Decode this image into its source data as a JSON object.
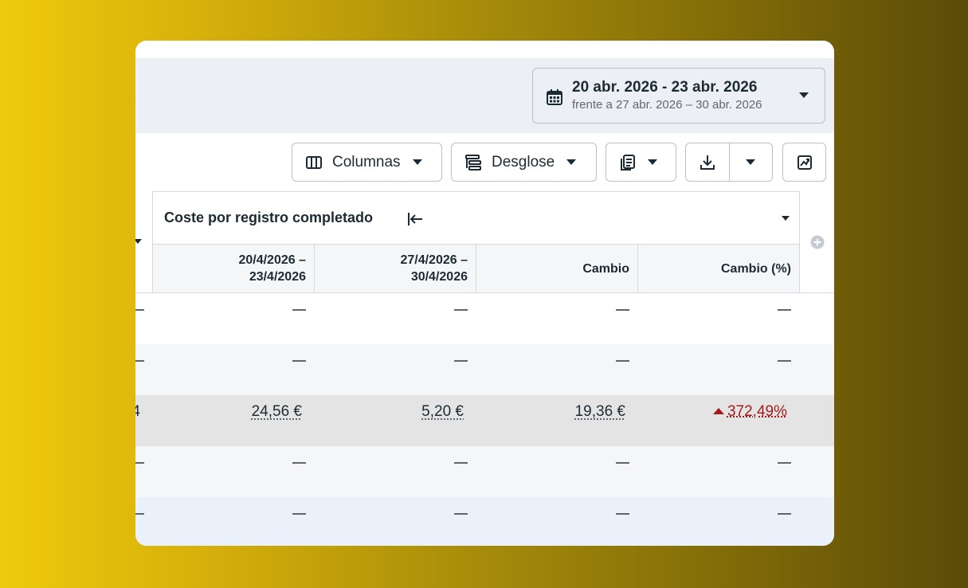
{
  "date_range": {
    "primary": "20 abr. 2026 - 23 abr. 2026",
    "comparison": "frente a 27 abr. 2026 – 30 abr. 2026",
    "icon": "calendar-icon"
  },
  "toolbar": {
    "columns_label": "Columnas",
    "breakdown_label": "Desglose",
    "reports_icon": "reports-icon",
    "export_icon": "download-icon",
    "chart_icon": "chart-icon"
  },
  "table": {
    "group_header": "Coste por registro completado",
    "columns": [
      "20/4/2026 –\n23/4/2026",
      "27/4/2026 –\n30/4/2026",
      "Cambio",
      "Cambio (%)"
    ],
    "rows": [
      {
        "left": "—",
        "cells": [
          "—",
          "—",
          "—",
          "—"
        ]
      },
      {
        "left": "—",
        "cells": [
          "—",
          "—",
          "—",
          "—"
        ]
      },
      {
        "left": "4",
        "cells": [
          "24,56 €",
          "5,20 €",
          "19,36 €",
          "372,49%"
        ],
        "change_direction": "up"
      },
      {
        "left": "—",
        "cells": [
          "—",
          "—",
          "—",
          "—"
        ]
      },
      {
        "left": "—",
        "cells": [
          "—",
          "—",
          "—",
          "—"
        ]
      }
    ]
  },
  "colors": {
    "negative_change": "#a11d1d",
    "header_band": "#eceff3",
    "highlight_row": "#e4e4e4",
    "selected_row": "#ebf1fb"
  }
}
